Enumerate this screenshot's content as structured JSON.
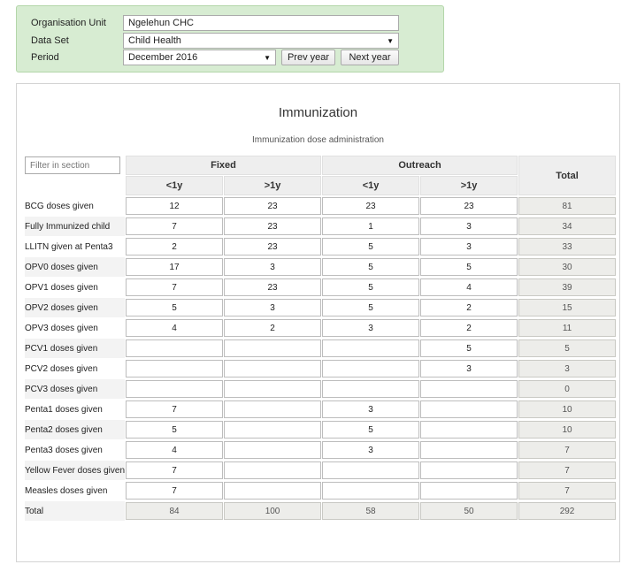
{
  "selection": {
    "org_unit_label": "Organisation Unit",
    "org_unit_value": "Ngelehun CHC",
    "data_set_label": "Data Set",
    "data_set_value": "Child Health",
    "period_label": "Period",
    "period_value": "December 2016",
    "prev_year": "Prev year",
    "next_year": "Next year",
    "arrow": "▼"
  },
  "form": {
    "title": "Immunization",
    "subtitle": "Immunization dose administration",
    "filter_placeholder": "Filter in section",
    "groups": [
      "Fixed",
      "Outreach"
    ],
    "subcols": [
      "<1y",
      ">1y",
      "<1y",
      ">1y"
    ],
    "total_header": "Total",
    "rows": [
      {
        "label": "BCG doses given",
        "values": [
          "12",
          "23",
          "23",
          "23"
        ],
        "total": "81"
      },
      {
        "label": "Fully Immunized child",
        "values": [
          "7",
          "23",
          "1",
          "3"
        ],
        "total": "34"
      },
      {
        "label": "LLITN given at Penta3",
        "values": [
          "2",
          "23",
          "5",
          "3"
        ],
        "total": "33"
      },
      {
        "label": "OPV0 doses given",
        "values": [
          "17",
          "3",
          "5",
          "5"
        ],
        "total": "30"
      },
      {
        "label": "OPV1 doses given",
        "values": [
          "7",
          "23",
          "5",
          "4"
        ],
        "total": "39"
      },
      {
        "label": "OPV2 doses given",
        "values": [
          "5",
          "3",
          "5",
          "2"
        ],
        "total": "15"
      },
      {
        "label": "OPV3 doses given",
        "values": [
          "4",
          "2",
          "3",
          "2"
        ],
        "total": "11"
      },
      {
        "label": "PCV1 doses given",
        "values": [
          "",
          "",
          "",
          "5"
        ],
        "total": "5"
      },
      {
        "label": "PCV2 doses given",
        "values": [
          "",
          "",
          "",
          "3"
        ],
        "total": "3"
      },
      {
        "label": "PCV3 doses given",
        "values": [
          "",
          "",
          "",
          ""
        ],
        "total": "0"
      },
      {
        "label": "Penta1 doses given",
        "values": [
          "7",
          "",
          "3",
          ""
        ],
        "total": "10"
      },
      {
        "label": "Penta2 doses given",
        "values": [
          "5",
          "",
          "5",
          ""
        ],
        "total": "10"
      },
      {
        "label": "Penta3 doses given",
        "values": [
          "4",
          "",
          "3",
          ""
        ],
        "total": "7"
      },
      {
        "label": "Yellow Fever doses given",
        "values": [
          "7",
          "",
          "",
          ""
        ],
        "total": "7"
      },
      {
        "label": "Measles doses given",
        "values": [
          "7",
          "",
          "",
          ""
        ],
        "total": "7"
      }
    ],
    "totals_row": {
      "label": "Total",
      "values": [
        "84",
        "100",
        "58",
        "50"
      ],
      "total": "292"
    }
  }
}
